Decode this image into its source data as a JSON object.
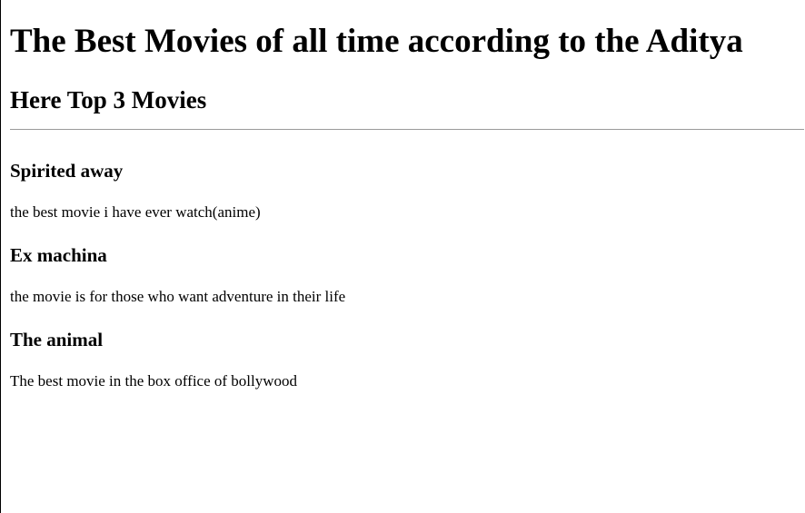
{
  "page": {
    "title": "The Best Movies of all time according to the Aditya",
    "subtitle": "Here Top 3 Movies"
  },
  "movies": [
    {
      "title": "Spirited away",
      "description": "the best movie i have ever watch(anime)"
    },
    {
      "title": "Ex machina",
      "description": "the movie is for those who want adventure in their life"
    },
    {
      "title": "The animal",
      "description": "The best movie in the box office of bollywood"
    }
  ]
}
